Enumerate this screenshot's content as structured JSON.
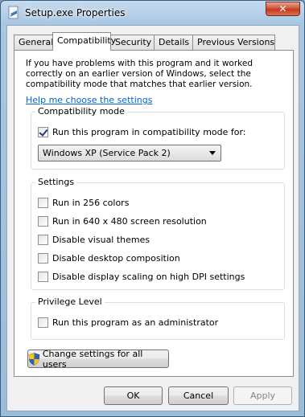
{
  "window": {
    "title": "Setup.exe Properties",
    "close_label": "✕"
  },
  "tabs": [
    {
      "label": "General"
    },
    {
      "label": "Compatibility",
      "active": true
    },
    {
      "label": "Security"
    },
    {
      "label": "Details"
    },
    {
      "label": "Previous Versions"
    }
  ],
  "compat": {
    "intro": "If you have problems with this program and it worked correctly on an earlier version of Windows, select the compatibility mode that matches that earlier version.",
    "help_link": "Help me choose the settings",
    "mode_group": {
      "title": "Compatibility mode",
      "checkbox_label": "Run this program in compatibility mode for:",
      "checked": true,
      "selected_mode": "Windows XP (Service Pack 2)"
    },
    "settings_group": {
      "title": "Settings",
      "items": [
        {
          "label": "Run in 256 colors",
          "checked": false
        },
        {
          "label": "Run in 640 x 480 screen resolution",
          "checked": false
        },
        {
          "label": "Disable visual themes",
          "checked": false
        },
        {
          "label": "Disable desktop composition",
          "checked": false
        },
        {
          "label": "Disable display scaling on high DPI settings",
          "checked": false
        }
      ]
    },
    "privilege_group": {
      "title": "Privilege Level",
      "checkbox_label": "Run this program as an administrator",
      "checked": false
    },
    "change_all_button": "Change settings for all users"
  },
  "buttons": {
    "ok": "OK",
    "cancel": "Cancel",
    "apply": "Apply"
  },
  "colors": {
    "link": "#0066cc",
    "title_bar": "#a9c7e3",
    "close_button": "#c23a1c"
  }
}
